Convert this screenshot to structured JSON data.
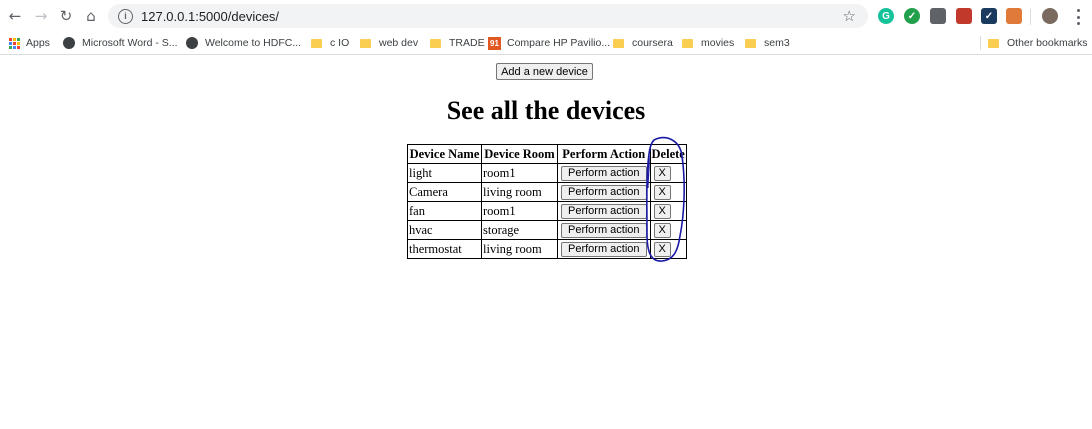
{
  "browser": {
    "url": "127.0.0.1:5000/devices/",
    "bookmarks": [
      {
        "label": "Apps",
        "icon": "apps-icon"
      },
      {
        "label": "Microsoft Word - S...",
        "icon": "globe-icon"
      },
      {
        "label": "Welcome to HDFC...",
        "icon": "globe-icon"
      },
      {
        "label": "c IO",
        "icon": "folder-icon"
      },
      {
        "label": "web dev",
        "icon": "folder-icon"
      },
      {
        "label": "TRADE",
        "icon": "folder-icon"
      },
      {
        "label": "Compare HP Pavilio...",
        "icon": "site-91-icon",
        "icon_text": "91"
      },
      {
        "label": "coursera",
        "icon": "folder-icon"
      },
      {
        "label": "movies",
        "icon": "folder-icon"
      },
      {
        "label": "sem3",
        "icon": "folder-icon"
      }
    ],
    "other_bookmarks": "Other bookmarks",
    "extensions": [
      {
        "name": "grammarly-icon",
        "text": "G",
        "color": "#15c39a"
      },
      {
        "name": "shield-check-icon",
        "text": "✓",
        "color": "#23a04b"
      },
      {
        "name": "pocket-icon",
        "text": "",
        "color": "#5f6368"
      },
      {
        "name": "pdf-icon",
        "text": "",
        "color": "#c0392b"
      },
      {
        "name": "checkmark-app-icon",
        "text": "✓",
        "color": "#1a3b5d"
      },
      {
        "name": "presentation-icon",
        "text": "",
        "color": "#e07a39"
      },
      {
        "name": "profile-avatar-icon",
        "text": "",
        "color": "#7a6a5f"
      }
    ]
  },
  "page": {
    "add_button": "Add a new device",
    "title": "See all the devices",
    "table": {
      "headers": [
        "Device Name",
        "Device Room",
        "Perform Action",
        "Delete"
      ],
      "rows": [
        {
          "name": "light",
          "room": "room1",
          "action": "Perform action",
          "delete": "X"
        },
        {
          "name": "Camera",
          "room": "living room",
          "action": "Perform action",
          "delete": "X"
        },
        {
          "name": "fan",
          "room": "room1",
          "action": "Perform action",
          "delete": "X"
        },
        {
          "name": "hvac",
          "room": "storage",
          "action": "Perform action",
          "delete": "X"
        },
        {
          "name": "thermostat",
          "room": "living room",
          "action": "Perform action",
          "delete": "X"
        }
      ]
    }
  },
  "colors": {
    "annotation": "#1a1aa6",
    "folder": "#f9ce51"
  }
}
